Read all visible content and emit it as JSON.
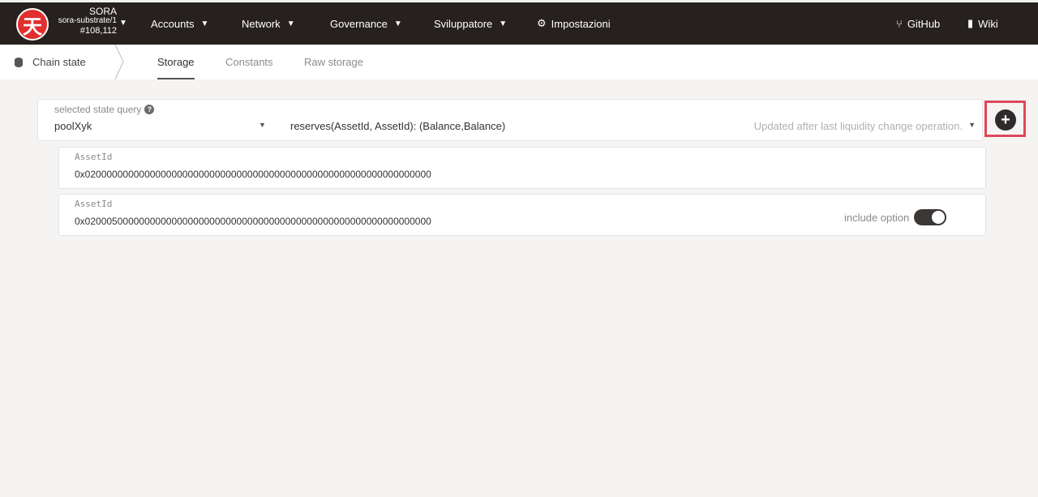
{
  "chain": {
    "logo_glyph": "天",
    "name": "SORA",
    "spec": "sora-substrate/1",
    "block": "#108,112"
  },
  "nav": {
    "accounts": "Accounts",
    "network": "Network",
    "governance": "Governance",
    "developer": "Sviluppatore",
    "settings": "Impostazioni",
    "github": "GitHub",
    "wiki": "Wiki"
  },
  "subnav": {
    "section": "Chain state",
    "tabs": [
      "Storage",
      "Constants",
      "Raw storage"
    ]
  },
  "query": {
    "label": "selected state query",
    "module": "poolXyk",
    "method": "reserves(AssetId, AssetId): (Balance,Balance)",
    "doc": "Updated after last liquidity change operation."
  },
  "params": [
    {
      "label": "AssetId",
      "value": "0x0200000000000000000000000000000000000000000000000000000000000000"
    },
    {
      "label": "AssetId",
      "value": "0x0200050000000000000000000000000000000000000000000000000000000000",
      "option_label": "include option",
      "option_on": true
    }
  ],
  "colors": {
    "topbar": "#26211f",
    "logo": "#e12f2f",
    "highlight": "#e0475a"
  }
}
